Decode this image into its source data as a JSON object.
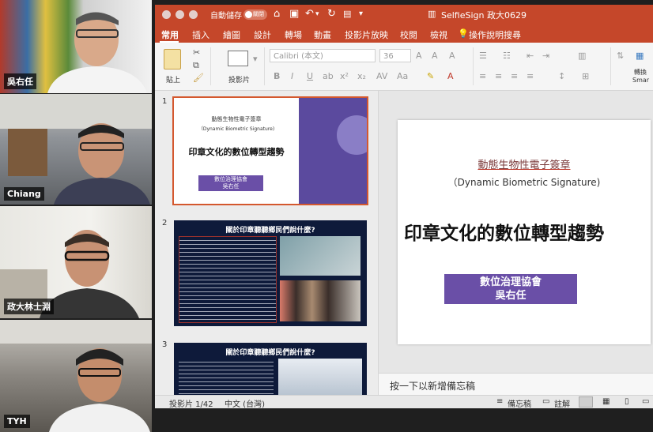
{
  "participants": [
    {
      "name": "吳右任",
      "bg": "#2b2b2b"
    },
    {
      "name": "Chiang",
      "bg": "#6a6f74"
    },
    {
      "name": "政大林士淵",
      "bg": "#e9e8e4"
    },
    {
      "name": "TYH",
      "bg": "#4a4844"
    }
  ],
  "window": {
    "autosave_label": "自動儲存",
    "toggle_state": "關閉",
    "title": "SelfieSign 政大0629"
  },
  "tabs": [
    "常用",
    "插入",
    "繪圖",
    "設計",
    "轉場",
    "動畫",
    "投影片放映",
    "校閱",
    "檢視",
    "操作說明搜尋"
  ],
  "ribbon": {
    "paste_label": "貼上",
    "slide_label": "投影片",
    "font_name": "Calibri (本文)",
    "font_size": "36",
    "right_label": "轉換",
    "right_label2": "Smar"
  },
  "slides": {
    "s1_num": "1",
    "s1_line1": "動態生物性電子簽章",
    "s1_line2": "（Dynamic Biometric Signature)",
    "s1_title": "印章文化的數位轉型趨勢",
    "s1_org": "數位治理協會",
    "s1_person": "吳右任",
    "s2_num": "2",
    "s2_title": "關於印章聽聽鄉民們說什麼?",
    "s3_num": "3",
    "s3_title": "關於印章聽聽鄉民們說什麼?"
  },
  "main_slide": {
    "line1": "動態生物性電子簽章",
    "line2": "（Dynamic Biometric Signature)",
    "title": "印章文化的數位轉型趨勢",
    "org": "數位治理協會",
    "person": "吳右任"
  },
  "notes_placeholder": "按一下以新增備忘稿",
  "status": {
    "slide_info": "投影片 1/42",
    "language": "中文 (台灣)",
    "notes_label": "備忘稿",
    "comments_label": "註解"
  },
  "colors": {
    "ppt_accent": "#c5472a",
    "slide_purple": "#6a4fa7",
    "slide_red": "#c0392b"
  }
}
